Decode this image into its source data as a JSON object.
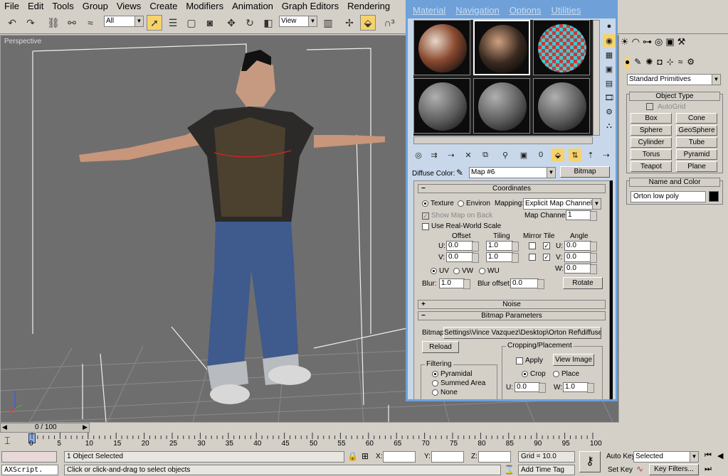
{
  "menu": [
    "File",
    "Edit",
    "Tools",
    "Group",
    "Views",
    "Create",
    "Modifiers",
    "Animation",
    "Graph Editors",
    "Rendering"
  ],
  "toolbar": {
    "selection_filter": "All",
    "ref_coord": "View"
  },
  "viewport": {
    "label": "Perspective"
  },
  "mat_editor": {
    "menu": [
      "Material",
      "Navigation",
      "Options",
      "Utilities"
    ],
    "diffuse_label": "Diffuse Color:",
    "map_name": "Map #6",
    "map_type": "Bitmap",
    "coordinates": {
      "title": "Coordinates",
      "texture": "Texture",
      "environ": "Environ",
      "mapping_label": "Mapping:",
      "mapping_value": "Explicit Map Channel",
      "show_map": "Show Map on Back",
      "map_channel_label": "Map Channel:",
      "map_channel": "1",
      "real_world": "Use Real-World Scale",
      "offset": "Offset",
      "tiling": "Tiling",
      "mirror_tile": "Mirror Tile",
      "angle": "Angle",
      "u_label": "U:",
      "v_label": "V:",
      "w_label": "W:",
      "u_offset": "0.0",
      "v_offset": "0.0",
      "u_tiling": "1.0",
      "v_tiling": "1.0",
      "u_angle": "0.0",
      "v_angle": "0.0",
      "w_angle": "0.0",
      "uv": "UV",
      "vw": "VW",
      "wu": "WU",
      "blur_label": "Blur:",
      "blur": "1.0",
      "blur_offset_label": "Blur offset:",
      "blur_offset": "0.0",
      "rotate": "Rotate"
    },
    "noise": "Noise",
    "bitmap_params": {
      "title": "Bitmap Parameters",
      "bitmap_label": "Bitmap:",
      "bitmap_path": "Settings\\Vince Vazquez\\Desktop\\Orton Ref\\diffuse.psd",
      "reload": "Reload",
      "cropping": "Cropping/Placement",
      "apply": "Apply",
      "view_image": "View Image",
      "crop": "Crop",
      "place": "Place",
      "filtering": "Filtering",
      "pyramidal": "Pyramidal",
      "summed_area": "Summed Area",
      "none": "None",
      "u_label": "U:",
      "w_label": "W:",
      "u_val": "0.0",
      "w_val": "1.0"
    }
  },
  "cmd_panel": {
    "category": "Standard Primitives",
    "object_type": "Object Type",
    "autogrid": "AutoGrid",
    "buttons": [
      "Box",
      "Cone",
      "Sphere",
      "GeoSphere",
      "Cylinder",
      "Tube",
      "Torus",
      "Pyramid",
      "Teapot",
      "Plane"
    ],
    "name_color": "Name and Color",
    "object_name": "Orton low poly"
  },
  "timeline": {
    "frame": "0 / 100",
    "ticks": [
      "0",
      "5",
      "10",
      "15",
      "20",
      "25",
      "30",
      "35",
      "40",
      "45",
      "50",
      "55",
      "60",
      "65",
      "70",
      "75",
      "80",
      "85",
      "90",
      "95",
      "100"
    ]
  },
  "status": {
    "maxscript": "AXScript.",
    "selected": "1 Object Selected",
    "prompt": "Click or click-and-drag to select objects",
    "x_label": "X:",
    "y_label": "Y:",
    "z_label": "Z:",
    "grid": "Grid = 10.0",
    "add_time_tag": "Add Time Tag",
    "auto_key": "Auto Key",
    "set_key": "Set Key",
    "key_mode": "Selected",
    "key_filters": "Key Filters..."
  }
}
